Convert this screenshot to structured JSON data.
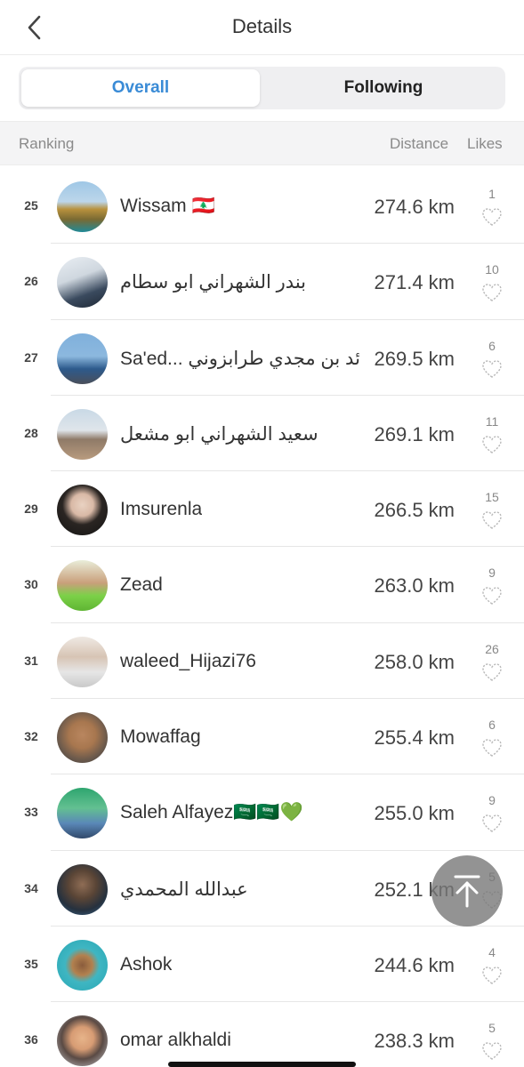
{
  "header": {
    "title": "Details",
    "back_icon": "chevron-left-icon"
  },
  "tabs": [
    {
      "label": "Overall",
      "active": true
    },
    {
      "label": "Following",
      "active": false
    }
  ],
  "columns": {
    "ranking": "Ranking",
    "distance": "Distance",
    "likes": "Likes"
  },
  "colors": {
    "accent": "#3a8bd6",
    "background": "#ffffff",
    "header_bg": "#f4f4f5"
  },
  "rows": [
    {
      "rank": "25",
      "name": "Wissam 🇱🇧",
      "distance": "274.6 km",
      "likes": "1",
      "avatar": "avatar-rock-sea"
    },
    {
      "rank": "26",
      "name": "بندر الشهراني ابو سطام",
      "distance": "271.4 km",
      "likes": "10",
      "avatar": "avatar-runner"
    },
    {
      "rank": "27",
      "name": "Sa'ed... سائد بن مجدي طرابزوني",
      "distance": "269.5 km",
      "likes": "6",
      "avatar": "avatar-man-sea"
    },
    {
      "rank": "28",
      "name": "سعيد الشهراني ابو مشعل",
      "distance": "269.1 km",
      "likes": "11",
      "avatar": "avatar-beach"
    },
    {
      "rank": "29",
      "name": "Imsurenla",
      "distance": "266.5 km",
      "likes": "15",
      "avatar": "avatar-woman"
    },
    {
      "rank": "30",
      "name": "Zead",
      "distance": "263.0 km",
      "likes": "9",
      "avatar": "avatar-man-green"
    },
    {
      "rank": "31",
      "name": "waleed_Hijazi76",
      "distance": "258.0 km",
      "likes": "26",
      "avatar": "avatar-man-white"
    },
    {
      "rank": "32",
      "name": "Mowaffag",
      "distance": "255.4 km",
      "likes": "6",
      "avatar": "avatar-man-smile"
    },
    {
      "rank": "33",
      "name": "Saleh Alfayez🇸🇦🇸🇦💚",
      "distance": "255.0 km",
      "likes": "9",
      "avatar": "avatar-man-sign"
    },
    {
      "rank": "34",
      "name": "عبدالله المحمدي",
      "distance": "252.1 km",
      "likes": "5",
      "avatar": "avatar-sunglasses"
    },
    {
      "rank": "35",
      "name": "Ashok",
      "distance": "244.6 km",
      "likes": "4",
      "avatar": "avatar-backpack"
    },
    {
      "rank": "36",
      "name": "omar alkhaldi",
      "distance": "238.3 km",
      "likes": "5",
      "avatar": "avatar-cartoon"
    }
  ],
  "scroll_top_icon": "arrow-up-to-top-icon"
}
